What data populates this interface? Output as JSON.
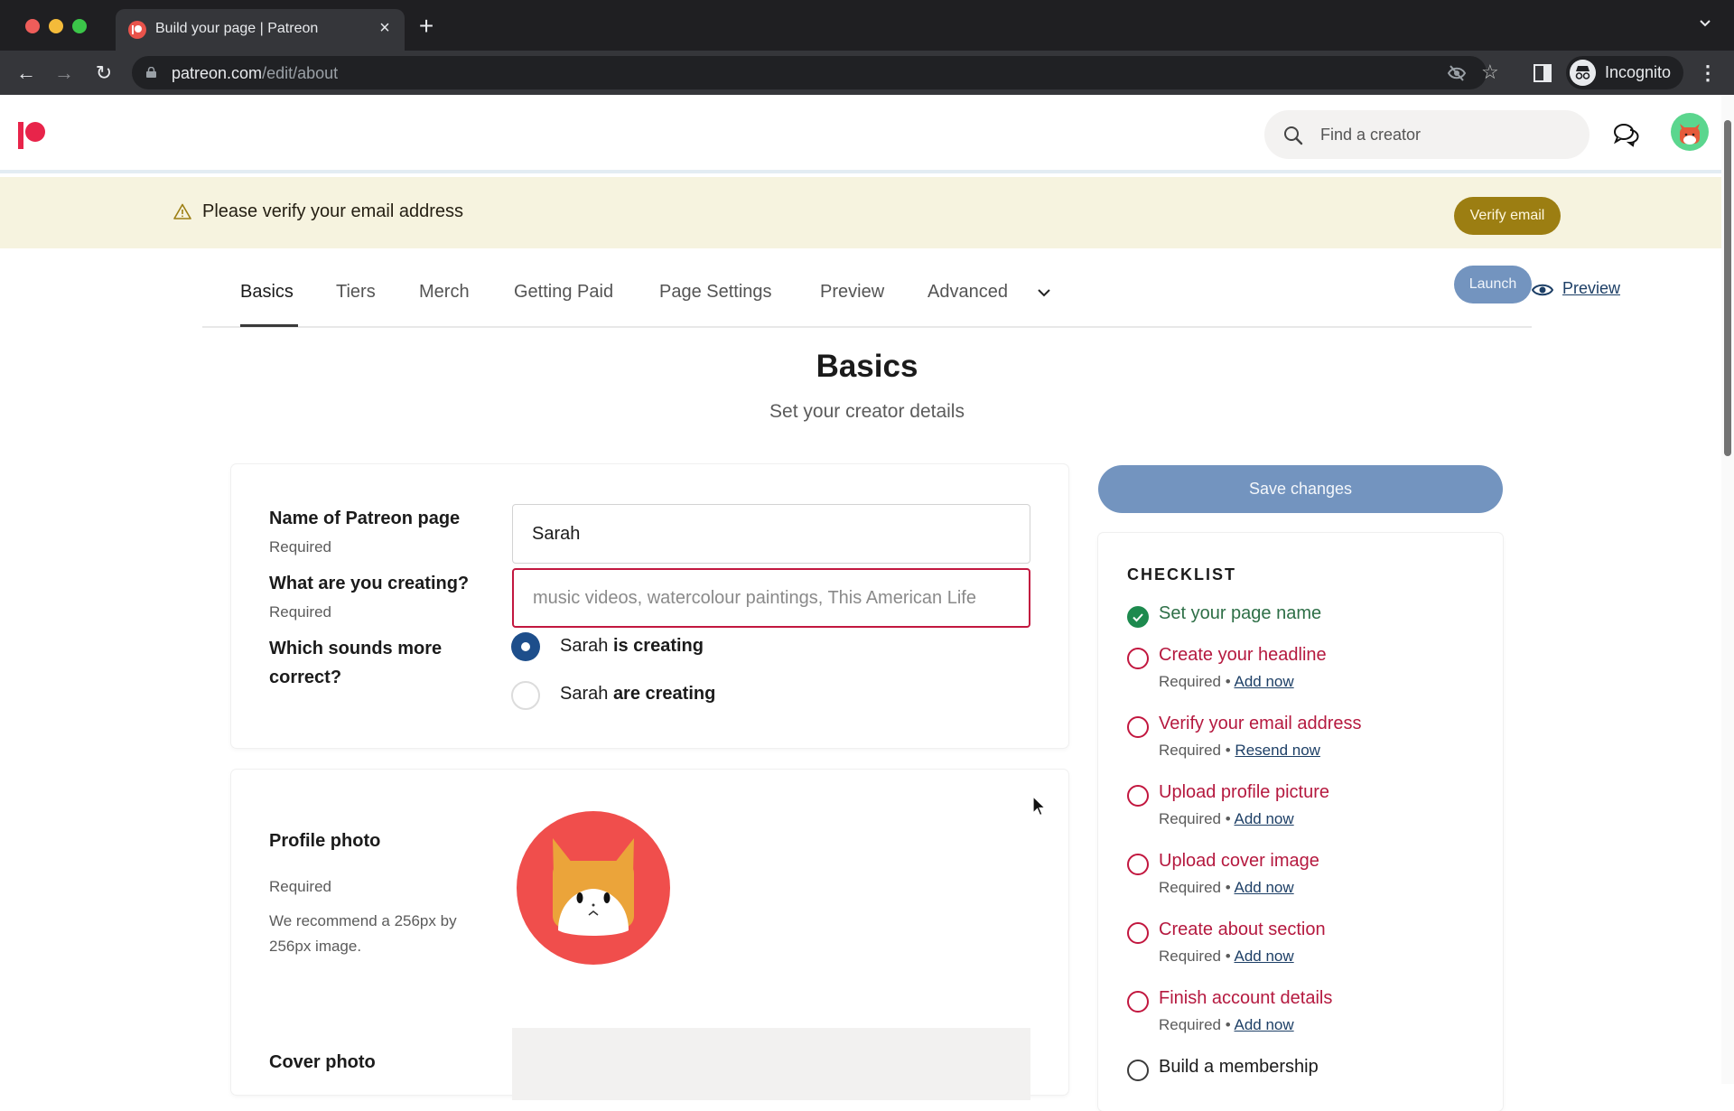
{
  "browser": {
    "tab_title": "Build your page | Patreon",
    "tab_close_glyph": "×",
    "new_tab_glyph": "+",
    "tab_list_glyph": "⌄",
    "url_host": "patreon.com",
    "url_path": "/edit/about",
    "back_glyph": "←",
    "forward_glyph": "→",
    "reload_glyph": "↻",
    "star_glyph": "☆",
    "menu_glyph": "⋮",
    "profile_label": "Incognito"
  },
  "header": {
    "search_placeholder": "Find a creator",
    "brand_color": "#e8244a"
  },
  "banner": {
    "message": "Please verify your email address",
    "button": "Verify email"
  },
  "nav": {
    "tabs": [
      {
        "label": "Basics",
        "active": true
      },
      {
        "label": "Tiers"
      },
      {
        "label": "Merch"
      },
      {
        "label": "Getting Paid"
      },
      {
        "label": "Page Settings"
      },
      {
        "label": "Preview"
      },
      {
        "label": "Advanced"
      }
    ],
    "preview_link": "Preview",
    "launch_button": "Launch"
  },
  "main": {
    "title": "Basics",
    "subtitle": "Set your creator details",
    "fields": {
      "page_name": {
        "label": "Name of Patreon page",
        "sub": "Required",
        "value": "Sarah"
      },
      "creating": {
        "label": "What are you creating?",
        "sub": "Required",
        "placeholder": "music videos, watercolour paintings, This American Life"
      },
      "grammar": {
        "label": "Which sounds more correct?",
        "options": [
          {
            "name": "Sarah",
            "verb": "is creating",
            "selected": true
          },
          {
            "name": "Sarah",
            "verb": "are creating",
            "selected": false
          }
        ]
      }
    },
    "profile_photo": {
      "label": "Profile photo",
      "sub": "Required",
      "hint": "We recommend a 256px by 256px image."
    },
    "cover_photo": {
      "label": "Cover photo"
    }
  },
  "sidebar": {
    "save_button": "Save changes",
    "checklist_title": "CHECKLIST",
    "items": [
      {
        "label": "Set your page name",
        "status": "done"
      },
      {
        "label": "Create your headline",
        "status": "todo",
        "req": "Required",
        "sep": "•",
        "action": "Add now"
      },
      {
        "label": "Verify your email address",
        "status": "todo",
        "req": "Required",
        "sep": "•",
        "action": "Resend now"
      },
      {
        "label": "Upload profile picture",
        "status": "todo",
        "req": "Required",
        "sep": "•",
        "action": "Add now"
      },
      {
        "label": "Upload cover image",
        "status": "todo",
        "req": "Required",
        "sep": "•",
        "action": "Add now"
      },
      {
        "label": "Create about section",
        "status": "todo",
        "req": "Required",
        "sep": "•",
        "action": "Add now"
      },
      {
        "label": "Finish account details",
        "status": "todo",
        "req": "Required",
        "sep": "•",
        "action": "Add now"
      },
      {
        "label": "Build a membership",
        "status": "optional"
      }
    ]
  }
}
